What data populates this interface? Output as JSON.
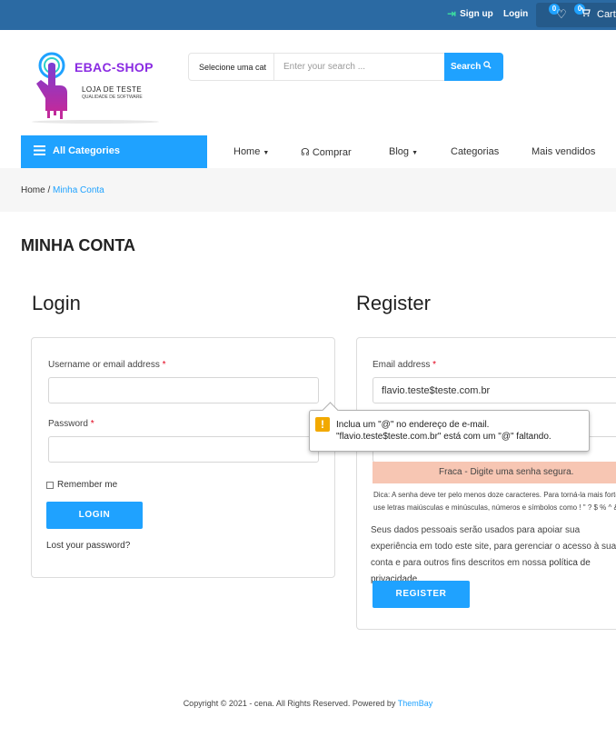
{
  "topbar": {
    "signup_label": "Sign up",
    "login_label": "Login",
    "wishlist_count": "0",
    "cart_count": "0",
    "cart_label": "Cart"
  },
  "header": {
    "logo_title": "EBAC-SHOP",
    "logo_subtitle": "LOJA DE TESTE",
    "logo_tagline": "QUALIDADE DE SOFTWARE",
    "search_category": "Selecione uma cat",
    "search_placeholder": "Enter your search ...",
    "search_button": "Search"
  },
  "nav": {
    "all_categories": "All Categories",
    "items": [
      "Home",
      "Comprar",
      "Blog",
      "Categorias",
      "Mais vendidos"
    ]
  },
  "breadcrumb": {
    "home": "Home",
    "separator": "/",
    "current": "Minha Conta"
  },
  "page_title": "MINHA CONTA",
  "login": {
    "heading": "Login",
    "username_label": "Username or email address",
    "password_label": "Password",
    "required_mark": "*",
    "username_value": "",
    "password_value": "",
    "remember_label": "Remember me",
    "button": "LOGIN",
    "lost_password": "Lost your password?"
  },
  "register": {
    "heading": "Register",
    "email_label": "Email address",
    "required_mark": "*",
    "email_value": "flavio.teste$teste.com.br",
    "strength_label": "Fraca - Digite uma senha segura.",
    "hint": "Dica: A senha deve ter pelo menos doze caracteres. Para torná-la mais forte, use letras maiúsculas e minúsculas, números e símbolos como ! \" ? $ % ^ & ).",
    "privacy_text": "Seus dados pessoais serão usados para apoiar sua experiência em todo este site, para gerenciar o acesso à sua conta e para outros fins descritos em nossa",
    "privacy_link": "política de privacidade",
    "privacy_end": ".",
    "button": "REGISTER"
  },
  "validation_tooltip": {
    "icon": "!",
    "message": "Inclua um \"@\" no endereço de e-mail. \"flavio.teste$teste.com.br\" está com um \"@\" faltando."
  },
  "footer": {
    "text": "Copyright © 2021 - cena. All Rights Reserved. Powered by",
    "brand": "ThemBay"
  },
  "colors": {
    "topbar": "#2b6aa3",
    "accent": "#1fa2ff",
    "logo": "#8a2be2",
    "strength_weak": "#f7c6b3",
    "warning": "#f2a900"
  }
}
